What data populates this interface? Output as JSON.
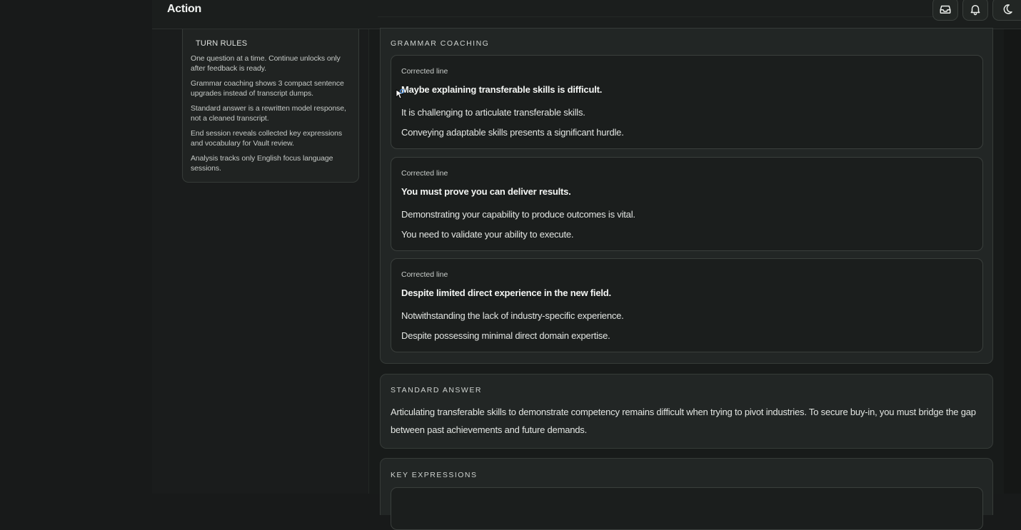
{
  "header": {
    "title": "Action"
  },
  "toolbar": {
    "inbox_icon": "inbox-icon",
    "bell_icon": "bell-icon",
    "theme_icon": "moon-icon"
  },
  "sidebar": {
    "turn_rules": {
      "heading": "TURN RULES",
      "items": [
        "One question at a time. Continue unlocks only after feedback is ready.",
        "Grammar coaching shows 3 compact sentence upgrades instead of transcript dumps.",
        "Standard answer is a rewritten model response, not a cleaned transcript.",
        "End session reveals collected key expressions and vocabulary for Vault review.",
        "Analysis tracks only English focus language sessions."
      ]
    }
  },
  "grammar_coaching": {
    "heading": "GRAMMAR COACHING",
    "cards": [
      {
        "label": "Corrected line",
        "original": "Maybe explaining transferable skills is difficult.",
        "alternatives": [
          "It is challenging to articulate transferable skills.",
          "Conveying adaptable skills presents a significant hurdle."
        ]
      },
      {
        "label": "Corrected line",
        "original": "You must prove you can deliver results.",
        "alternatives": [
          "Demonstrating your capability to produce outcomes is vital.",
          "You need to validate your ability to execute."
        ]
      },
      {
        "label": "Corrected line",
        "original": "Despite limited direct experience in the new field.",
        "alternatives": [
          "Notwithstanding the lack of industry-specific experience.",
          "Despite possessing minimal direct domain expertise."
        ]
      }
    ]
  },
  "standard_answer": {
    "heading": "STANDARD ANSWER",
    "text": "Articulating transferable skills to demonstrate competency remains difficult when trying to pivot industries. To secure buy-in, you must bridge the gap between past achievements and future demands."
  },
  "key_expressions": {
    "heading": "KEY EXPRESSIONS"
  },
  "colors": {
    "background": "#181a1a",
    "card": "#222625",
    "border": "#363b38",
    "text": "#e6e8e6"
  }
}
